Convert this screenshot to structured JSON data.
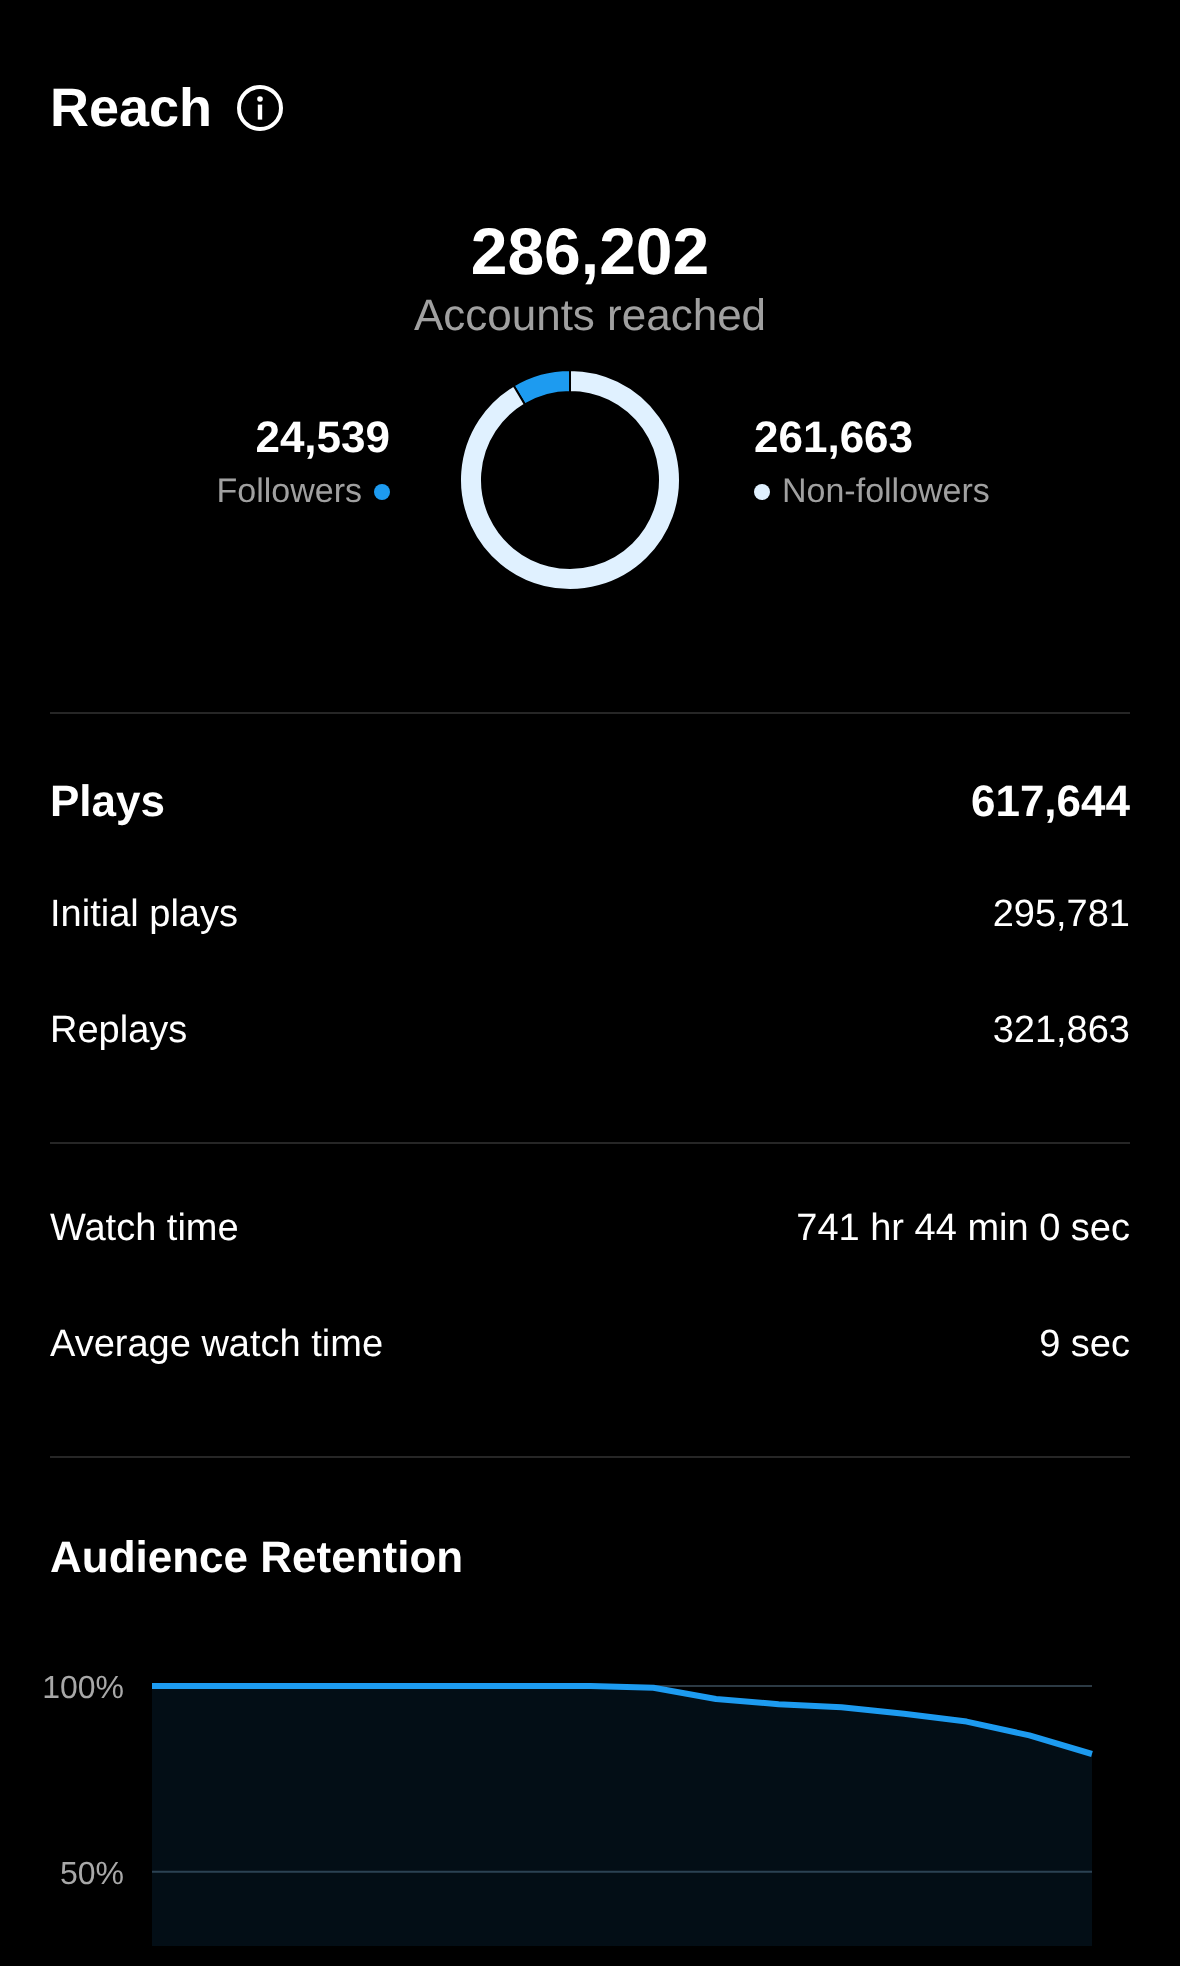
{
  "reach": {
    "title": "Reach",
    "total": "286,202",
    "total_label": "Accounts reached",
    "segments": [
      {
        "value": "24,539",
        "color": "#1d9bf0"
      },
      {
        "value": "261,663",
        "color": "#e0f1ff"
      }
    ],
    "chart_data": {
      "type": "donut",
      "categories": [
        "Followers",
        "Non-followers"
      ],
      "values": [
        8.57,
        91.43
      ]
    }
  },
  "groups": [
    {
      "rows": [
        {
          "label": "Plays",
          "value": "617,644",
          "kind": "header"
        },
        {
          "label": "Initial plays",
          "value": "295,781",
          "kind": "row"
        },
        {
          "label": "Replays",
          "value": "321,863",
          "kind": "row"
        }
      ]
    },
    {
      "rows": [
        {
          "label": "Watch time",
          "value": "741 hr 44 min 0 sec",
          "kind": "row"
        },
        {
          "label": "Average watch time",
          "value": "9 sec",
          "kind": "row"
        }
      ]
    }
  ],
  "retention": {
    "title": "Audience Retention",
    "chart_data": {
      "type": "area",
      "categories": [
        null,
        null,
        null,
        null,
        null,
        null,
        null,
        null,
        null,
        null,
        null,
        null,
        null,
        null,
        null,
        null
      ],
      "series": [
        {
          "color": "#1d9bf0",
          "values": [
            100,
            100,
            100,
            100,
            100,
            100,
            100,
            100,
            99.5,
            96.5,
            95.1,
            94.3,
            92.5,
            90.4,
            86.7,
            81.7
          ]
        }
      ],
      "ylim": [
        30,
        100
      ],
      "yticks": [
        {
          "value": 100,
          "label": "100%"
        },
        {
          "value": 50,
          "label": "50%"
        }
      ]
    }
  }
}
